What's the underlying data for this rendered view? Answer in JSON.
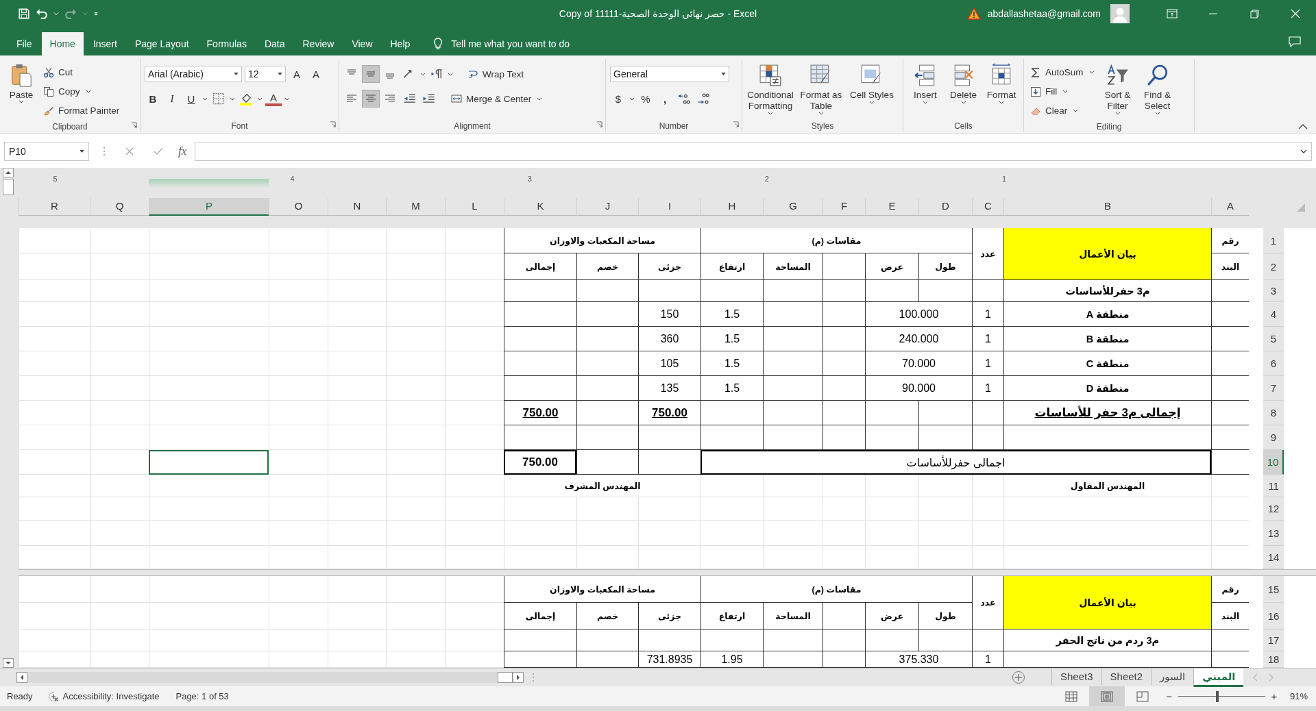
{
  "title_bar": {
    "title": "Copy of 11111-حصر نهائي الوحدة الصحية  -  Excel",
    "account": "abdallashetaa@gmail.com"
  },
  "menu_tabs": {
    "file": {
      "label": "File",
      "selected": false
    },
    "home": {
      "label": "Home",
      "selected": true
    },
    "insert": {
      "label": "Insert",
      "selected": false
    },
    "page_layout": {
      "label": "Page Layout",
      "selected": false
    },
    "formulas": {
      "label": "Formulas",
      "selected": false
    },
    "data": {
      "label": "Data",
      "selected": false
    },
    "review": {
      "label": "Review",
      "selected": false
    },
    "view": {
      "label": "View",
      "selected": false
    },
    "help": {
      "label": "Help",
      "selected": false
    }
  },
  "tell_me": {
    "placeholder": "Tell me what you want to do"
  },
  "ribbon": {
    "clipboard": {
      "label": "Clipboard",
      "paste": "Paste",
      "cut": "Cut",
      "copy": "Copy",
      "format_painter": "Format Painter"
    },
    "font": {
      "label": "Font",
      "font_name": "Arial (Arabic)",
      "font_size": "12",
      "grow": "A",
      "shrink": "A",
      "bold": "B",
      "italic": "I",
      "underline": "U",
      "font_color": "A"
    },
    "alignment": {
      "label": "Alignment",
      "wrap_text": "Wrap Text",
      "merge_center": "Merge & Center",
      "vertical": [
        {
          "selected": false
        },
        {
          "selected": true
        },
        {
          "selected": false
        }
      ],
      "horizontal": [
        {
          "selected": false
        },
        {
          "selected": true
        },
        {
          "selected": false
        }
      ]
    },
    "number": {
      "label": "Number",
      "format": "General",
      "currency": "$",
      "percent": "%",
      "comma": ","
    },
    "styles": {
      "label": "Styles",
      "conditional_formatting": "Conditional Formatting",
      "format_as_table": "Format as Table",
      "cell_styles": "Cell Styles"
    },
    "cells": {
      "label": "Cells",
      "insert": "Insert",
      "delete": "Delete",
      "format": "Format"
    },
    "editing": {
      "label": "Editing",
      "autosum": "AutoSum",
      "fill": "Fill",
      "clear": "Clear",
      "sort_filter": "Sort & Filter",
      "find_select": "Find & Select"
    }
  },
  "formula_bar": {
    "name_box": "P10",
    "function_label": "fx"
  },
  "sheet": {
    "ruler": [
      "1",
      "2",
      "3",
      "4",
      "5"
    ],
    "columns": [
      {
        "label": "A",
        "selected": false
      },
      {
        "label": "B",
        "selected": false
      },
      {
        "label": "C",
        "selected": false
      },
      {
        "label": "D",
        "selected": false
      },
      {
        "label": "E",
        "selected": false
      },
      {
        "label": "F",
        "selected": false
      },
      {
        "label": "G",
        "selected": false
      },
      {
        "label": "H",
        "selected": false
      },
      {
        "label": "I",
        "selected": false
      },
      {
        "label": "J",
        "selected": false
      },
      {
        "label": "K",
        "selected": false
      },
      {
        "label": "L",
        "selected": false
      },
      {
        "label": "M",
        "selected": false
      },
      {
        "label": "N",
        "selected": false
      },
      {
        "label": "O",
        "selected": false
      },
      {
        "label": "P",
        "selected": true
      },
      {
        "label": "Q",
        "selected": false
      },
      {
        "label": "R",
        "selected": false
      }
    ],
    "pages": [
      {
        "rows": [
          {
            "number": "1",
            "selected": false,
            "bordered": true,
            "kind": "heading",
            "cells": [
              {
                "kind": "text",
                "text": "رقم",
                "bold": true
              },
              {
                "kind": "text",
                "text": "بيان الأعمال",
                "bold": true,
                "highlight": true
              },
              {
                "kind": "text",
                "text": "عدد",
                "bold": true
              },
              {
                "kind": "text",
                "text": "مقاسات (م)",
                "bold": true
              },
              {
                "kind": "span"
              },
              {
                "kind": "span"
              },
              {
                "kind": "span"
              },
              {
                "kind": "span"
              },
              {
                "kind": "text",
                "text": "مساحة المكعبات والاوزان",
                "bold": true
              },
              {
                "kind": "span"
              },
              {
                "kind": "span"
              }
            ]
          },
          {
            "number": "2",
            "selected": false,
            "bordered": true,
            "kind": "heading",
            "cells": [
              {
                "kind": "text",
                "text": "البند",
                "bold": true
              },
              {
                "kind": "below"
              },
              {
                "kind": "below"
              },
              {
                "kind": "text",
                "text": "طول",
                "bold": true
              },
              {
                "kind": "text",
                "text": "عرض",
                "bold": true
              },
              {
                "kind": "empty"
              },
              {
                "kind": "text",
                "text": "المساحة",
                "bold": true
              },
              {
                "kind": "text",
                "text": "ارتفاع",
                "bold": true
              },
              {
                "kind": "text",
                "text": "جزئى",
                "bold": true
              },
              {
                "kind": "text",
                "text": "خصم",
                "bold": true
              },
              {
                "kind": "text",
                "text": "إجمالى",
                "bold": true
              }
            ]
          },
          {
            "number": "3",
            "selected": false,
            "bordered": true,
            "kind": "body",
            "cells": [
              {
                "kind": "empty"
              },
              {
                "kind": "text",
                "text": "م3 حفرللأساسات",
                "bold": true
              },
              {
                "kind": "empty"
              },
              {
                "kind": "empty"
              },
              {
                "kind": "empty"
              },
              {
                "kind": "empty"
              },
              {
                "kind": "empty"
              },
              {
                "kind": "empty"
              },
              {
                "kind": "empty"
              },
              {
                "kind": "empty"
              },
              {
                "kind": "empty"
              }
            ]
          },
          {
            "number": "4",
            "selected": false,
            "bordered": true,
            "kind": "body",
            "cells": [
              {
                "kind": "empty"
              },
              {
                "kind": "text",
                "text": "منطقة A",
                "bold": true
              },
              {
                "kind": "text",
                "text": "1"
              },
              {
                "kind": "text",
                "text": "100.000"
              },
              {
                "kind": "span"
              },
              {
                "kind": "empty"
              },
              {
                "kind": "empty"
              },
              {
                "kind": "text",
                "text": "1.5"
              },
              {
                "kind": "text",
                "text": "150"
              },
              {
                "kind": "empty"
              },
              {
                "kind": "empty"
              }
            ]
          },
          {
            "number": "5",
            "selected": false,
            "bordered": true,
            "kind": "body",
            "cells": [
              {
                "kind": "empty"
              },
              {
                "kind": "text",
                "text": "منطقة B",
                "bold": true
              },
              {
                "kind": "text",
                "text": "1"
              },
              {
                "kind": "text",
                "text": "240.000"
              },
              {
                "kind": "span"
              },
              {
                "kind": "empty"
              },
              {
                "kind": "empty"
              },
              {
                "kind": "text",
                "text": "1.5"
              },
              {
                "kind": "text",
                "text": "360"
              },
              {
                "kind": "empty"
              },
              {
                "kind": "empty"
              }
            ]
          },
          {
            "number": "6",
            "selected": false,
            "bordered": true,
            "kind": "body",
            "cells": [
              {
                "kind": "empty"
              },
              {
                "kind": "text",
                "text": "منطقة C",
                "bold": true
              },
              {
                "kind": "text",
                "text": "1"
              },
              {
                "kind": "text",
                "text": "70.000"
              },
              {
                "kind": "span"
              },
              {
                "kind": "empty"
              },
              {
                "kind": "empty"
              },
              {
                "kind": "text",
                "text": "1.5"
              },
              {
                "kind": "text",
                "text": "105"
              },
              {
                "kind": "empty"
              },
              {
                "kind": "empty"
              }
            ]
          },
          {
            "number": "7",
            "selected": false,
            "bordered": true,
            "kind": "body",
            "cells": [
              {
                "kind": "empty"
              },
              {
                "kind": "text",
                "text": "منطقة D",
                "bold": true
              },
              {
                "kind": "text",
                "text": "1"
              },
              {
                "kind": "text",
                "text": "90.000"
              },
              {
                "kind": "span"
              },
              {
                "kind": "empty"
              },
              {
                "kind": "empty"
              },
              {
                "kind": "text",
                "text": "1.5"
              },
              {
                "kind": "text",
                "text": "135"
              },
              {
                "kind": "empty"
              },
              {
                "kind": "empty"
              }
            ]
          },
          {
            "number": "8",
            "selected": false,
            "bordered": true,
            "kind": "body",
            "cells": [
              {
                "kind": "empty"
              },
              {
                "kind": "text",
                "text": "إجمالى م3 حفر للأساسات",
                "bold": true,
                "underline": true
              },
              {
                "kind": "empty"
              },
              {
                "kind": "empty"
              },
              {
                "kind": "empty"
              },
              {
                "kind": "empty"
              },
              {
                "kind": "empty"
              },
              {
                "kind": "empty"
              },
              {
                "kind": "text",
                "text": "750.00",
                "bold": true,
                "underline": true
              },
              {
                "kind": "empty"
              },
              {
                "kind": "text",
                "text": "750.00",
                "bold": true,
                "underline": true
              }
            ]
          },
          {
            "number": "9",
            "selected": false,
            "bordered": true,
            "kind": "body",
            "cells": [
              {
                "kind": "empty"
              },
              {
                "kind": "empty"
              },
              {
                "kind": "empty"
              },
              {
                "kind": "empty"
              },
              {
                "kind": "empty"
              },
              {
                "kind": "empty"
              },
              {
                "kind": "empty"
              },
              {
                "kind": "empty"
              },
              {
                "kind": "empty"
              },
              {
                "kind": "empty"
              },
              {
                "kind": "empty"
              }
            ]
          },
          {
            "number": "10",
            "selected": true,
            "bordered": true,
            "kind": "body",
            "cells": [
              {
                "kind": "empty"
              },
              {
                "kind": "lead"
              },
              {
                "kind": "text",
                "text": "اجمالى حفرللأساسات",
                "boxed": true
              },
              {
                "kind": "span"
              },
              {
                "kind": "span"
              },
              {
                "kind": "span"
              },
              {
                "kind": "span"
              },
              {
                "kind": "span"
              },
              {
                "kind": "empty"
              },
              {
                "kind": "empty"
              },
              {
                "kind": "text",
                "text": "750.00",
                "bold": true,
                "boxed": true
              }
            ]
          },
          {
            "number": "11",
            "selected": false,
            "bordered": false,
            "kind": "heading",
            "cells": [
              {
                "kind": "empty"
              },
              {
                "kind": "text",
                "text": "المهندس المقاول",
                "bold": true
              },
              {
                "kind": "empty"
              },
              {
                "kind": "empty"
              },
              {
                "kind": "empty"
              },
              {
                "kind": "empty"
              },
              {
                "kind": "empty"
              },
              {
                "kind": "empty"
              },
              {
                "kind": "text",
                "text": "المهندس المشرف",
                "bold": true
              },
              {
                "kind": "span"
              },
              {
                "kind": "span"
              }
            ]
          },
          {
            "number": "12",
            "selected": false,
            "bordered": false,
            "kind": "body",
            "cells": [
              {
                "kind": "empty"
              },
              {
                "kind": "empty"
              },
              {
                "kind": "empty"
              },
              {
                "kind": "empty"
              },
              {
                "kind": "empty"
              },
              {
                "kind": "empty"
              },
              {
                "kind": "empty"
              },
              {
                "kind": "empty"
              },
              {
                "kind": "empty"
              },
              {
                "kind": "empty"
              },
              {
                "kind": "empty"
              }
            ]
          },
          {
            "number": "13",
            "selected": false,
            "bordered": false,
            "kind": "body",
            "cells": [
              {
                "kind": "empty"
              },
              {
                "kind": "empty"
              },
              {
                "kind": "empty"
              },
              {
                "kind": "empty"
              },
              {
                "kind": "empty"
              },
              {
                "kind": "empty"
              },
              {
                "kind": "empty"
              },
              {
                "kind": "empty"
              },
              {
                "kind": "empty"
              },
              {
                "kind": "empty"
              },
              {
                "kind": "empty"
              }
            ]
          },
          {
            "number": "14",
            "selected": false,
            "bordered": false,
            "kind": "body",
            "cells": [
              {
                "kind": "empty"
              },
              {
                "kind": "empty"
              },
              {
                "kind": "empty"
              },
              {
                "kind": "empty"
              },
              {
                "kind": "empty"
              },
              {
                "kind": "empty"
              },
              {
                "kind": "empty"
              },
              {
                "kind": "empty"
              },
              {
                "kind": "empty"
              },
              {
                "kind": "empty"
              },
              {
                "kind": "empty"
              }
            ]
          }
        ]
      },
      {
        "rows": [
          {
            "number": "15",
            "selected": false,
            "bordered": true,
            "kind": "heading",
            "cells": [
              {
                "kind": "text",
                "text": "رقم",
                "bold": true
              },
              {
                "kind": "text",
                "text": "بيان الأعمال",
                "bold": true,
                "highlight": true
              },
              {
                "kind": "text",
                "text": "عدد",
                "bold": true
              },
              {
                "kind": "text",
                "text": "مقاسات (م)",
                "bold": true
              },
              {
                "kind": "span"
              },
              {
                "kind": "span"
              },
              {
                "kind": "span"
              },
              {
                "kind": "span"
              },
              {
                "kind": "text",
                "text": "مساحة المكعبات والاوزان",
                "bold": true
              },
              {
                "kind": "span"
              },
              {
                "kind": "span"
              }
            ]
          },
          {
            "number": "16",
            "selected": false,
            "bordered": true,
            "kind": "heading",
            "cells": [
              {
                "kind": "text",
                "text": "البند",
                "bold": true
              },
              {
                "kind": "below"
              },
              {
                "kind": "below"
              },
              {
                "kind": "text",
                "text": "طول",
                "bold": true
              },
              {
                "kind": "text",
                "text": "عرض",
                "bold": true
              },
              {
                "kind": "empty"
              },
              {
                "kind": "text",
                "text": "المساحة",
                "bold": true
              },
              {
                "kind": "text",
                "text": "ارتفاع",
                "bold": true
              },
              {
                "kind": "text",
                "text": "جزئى",
                "bold": true
              },
              {
                "kind": "text",
                "text": "خصم",
                "bold": true
              },
              {
                "kind": "text",
                "text": "إجمالى",
                "bold": true
              }
            ]
          },
          {
            "number": "17",
            "selected": false,
            "bordered": true,
            "kind": "body",
            "cells": [
              {
                "kind": "empty"
              },
              {
                "kind": "text",
                "text": "م3 ردم من ناتج الحفر",
                "bold": true
              },
              {
                "kind": "empty"
              },
              {
                "kind": "empty"
              },
              {
                "kind": "empty"
              },
              {
                "kind": "empty"
              },
              {
                "kind": "empty"
              },
              {
                "kind": "empty"
              },
              {
                "kind": "empty"
              },
              {
                "kind": "empty"
              },
              {
                "kind": "empty"
              }
            ]
          },
          {
            "number": "18",
            "selected": false,
            "bordered": true,
            "kind": "body",
            "cells": [
              {
                "kind": "empty"
              },
              {
                "kind": "empty"
              },
              {
                "kind": "text",
                "text": "1"
              },
              {
                "kind": "text",
                "text": "375.330"
              },
              {
                "kind": "span"
              },
              {
                "kind": "empty"
              },
              {
                "kind": "empty"
              },
              {
                "kind": "text",
                "text": "1.95"
              },
              {
                "kind": "text",
                "text": "731.8935"
              },
              {
                "kind": "empty"
              },
              {
                "kind": "empty"
              }
            ]
          }
        ]
      }
    ]
  },
  "sheet_tabs": [
    {
      "label": "المبني",
      "selected": true
    },
    {
      "label": "السور",
      "selected": false
    },
    {
      "label": "Sheet2",
      "selected": false
    },
    {
      "label": "Sheet3",
      "selected": false
    }
  ],
  "status_bar": {
    "mode": "Ready",
    "accessibility": "Accessibility: Investigate",
    "page": "Page: 1 of 53",
    "views": [
      {
        "kind": "normal",
        "selected": false
      },
      {
        "kind": "page_layout",
        "selected": true
      },
      {
        "kind": "page_break",
        "selected": false
      }
    ],
    "zoom_out": "−",
    "zoom_in": "+",
    "zoom_slider": {
      "level": 0.45
    },
    "zoom": "91%"
  }
}
